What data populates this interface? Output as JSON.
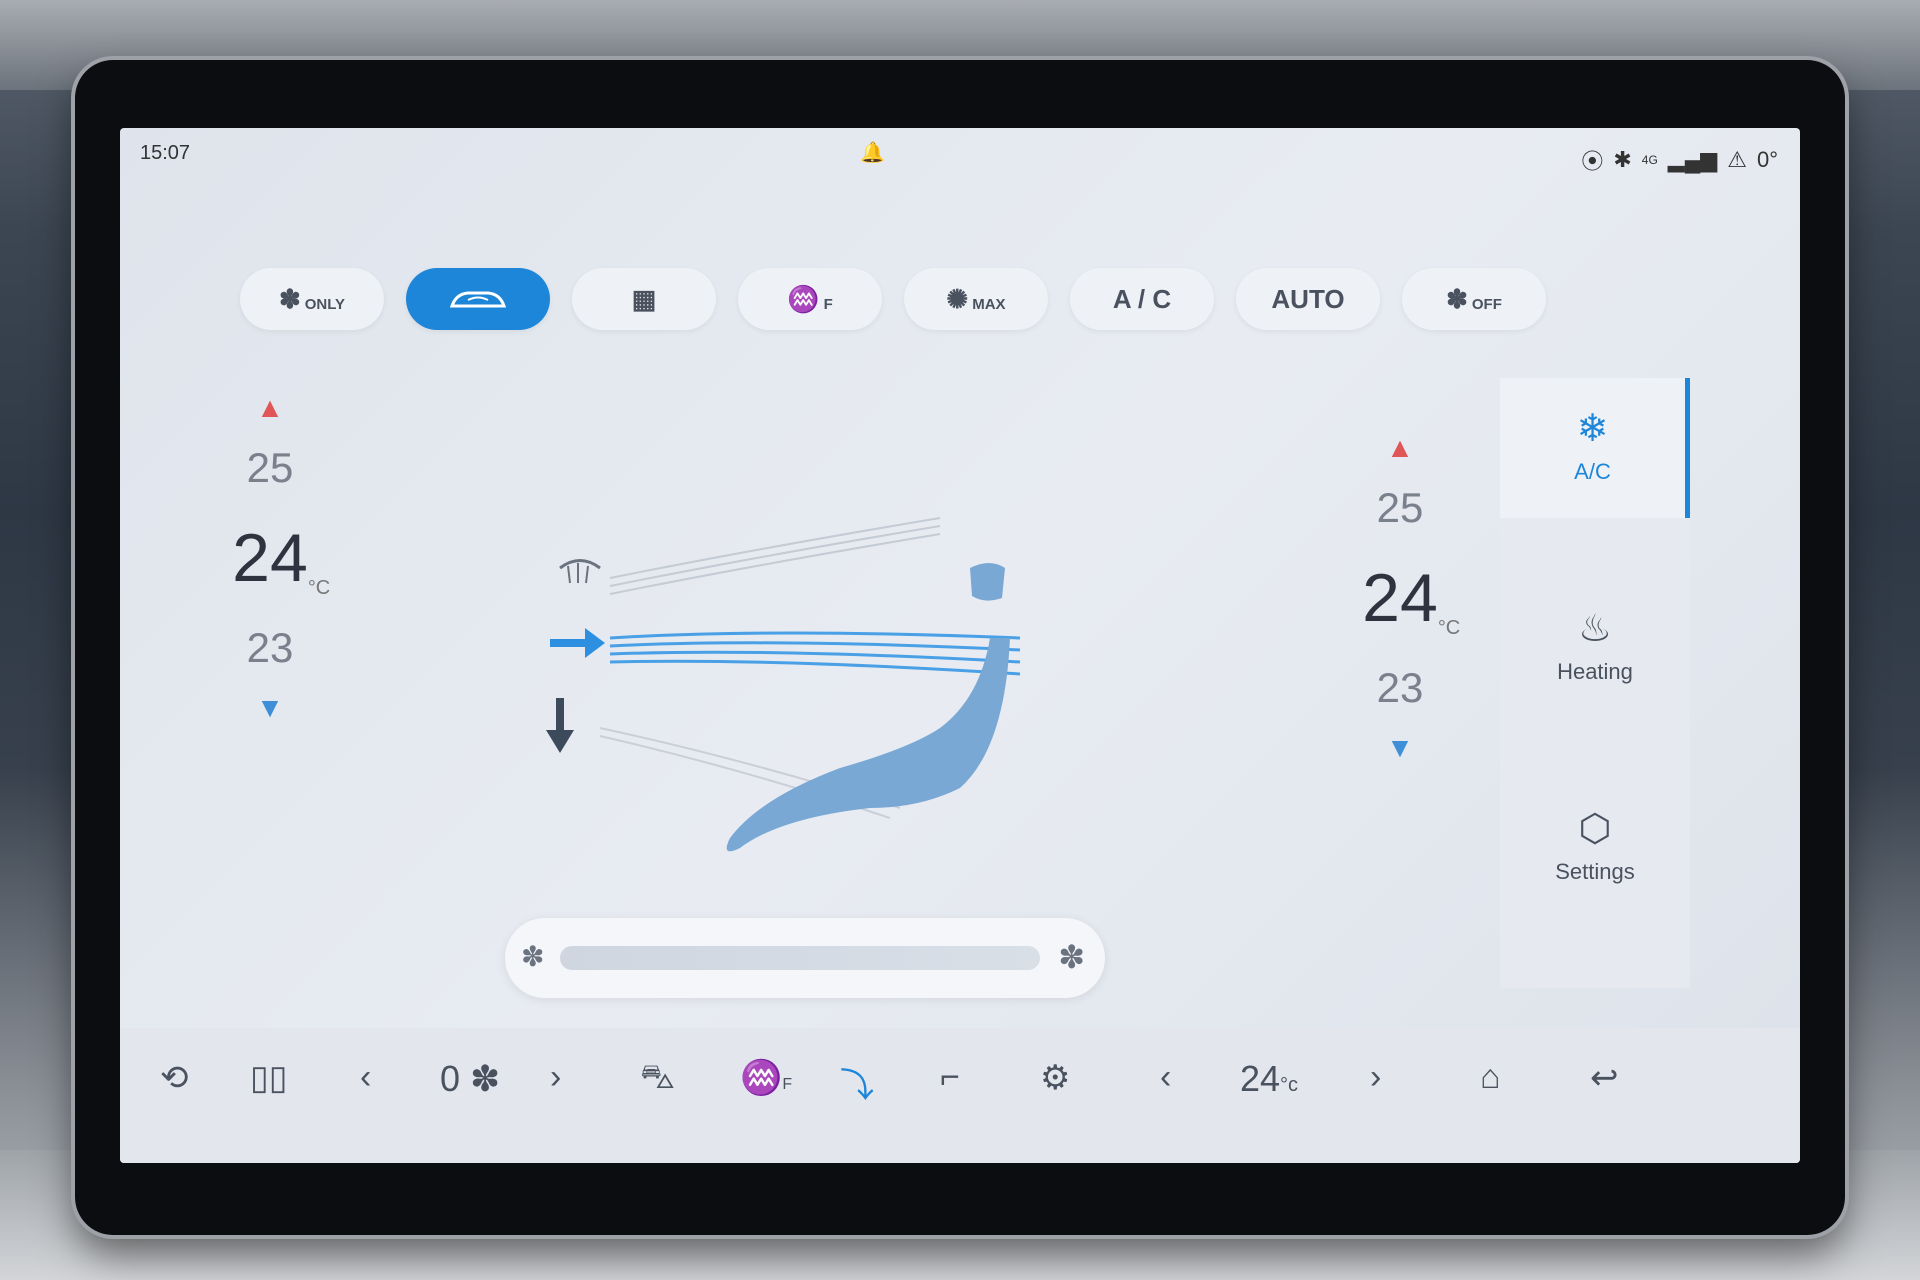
{
  "status": {
    "time": "15:07",
    "network": "4G",
    "temperature": "0°"
  },
  "modes": [
    {
      "icon": "fan-icon",
      "label": "",
      "sub": "ONLY",
      "active": false
    },
    {
      "icon": "car-recirculation-icon",
      "label": "",
      "sub": "",
      "active": true
    },
    {
      "icon": "rear-defrost-icon",
      "label": "",
      "sub": "",
      "active": false
    },
    {
      "icon": "front-defrost-icon",
      "label": "",
      "sub": "F",
      "active": false
    },
    {
      "icon": "max-cool-icon",
      "label": "",
      "sub": "MAX",
      "active": false
    },
    {
      "icon": "",
      "label": "A / C",
      "sub": "",
      "active": false
    },
    {
      "icon": "",
      "label": "AUTO",
      "sub": "",
      "active": false
    },
    {
      "icon": "fan-icon",
      "label": "",
      "sub": "OFF",
      "active": false
    }
  ],
  "driver_temp": {
    "above": "25",
    "current": "24",
    "below": "23",
    "unit": "°C"
  },
  "passenger_temp": {
    "above": "25",
    "current": "24",
    "below": "23",
    "unit": "°C"
  },
  "fan_slider": {
    "level": 0
  },
  "side_nav": [
    {
      "icon": "snowflake-icon",
      "label": "A/C",
      "active": true
    },
    {
      "icon": "seat-heating-icon",
      "label": "Heating",
      "active": false
    },
    {
      "icon": "settings-hexagon-icon",
      "label": "Settings",
      "active": false
    }
  ],
  "bottom_bar": {
    "fan_speed": "0",
    "temp": "24",
    "temp_unit": "°c",
    "defrost_suffix": "F"
  },
  "colors": {
    "accent": "#1e86d8",
    "up_arrow": "#e05555",
    "down_arrow": "#3e8fd8"
  }
}
